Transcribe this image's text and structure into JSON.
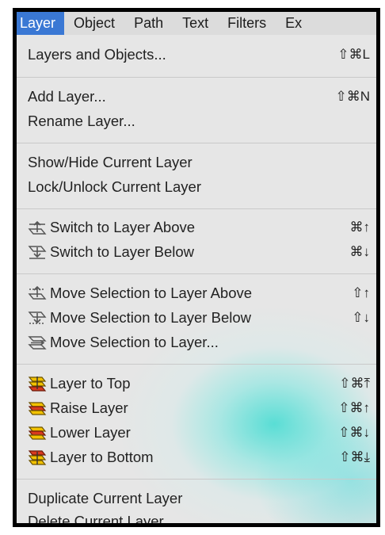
{
  "menubar": {
    "items": [
      "Layer",
      "Object",
      "Path",
      "Text",
      "Filters",
      "Ex"
    ]
  },
  "menu": {
    "layers_objects": {
      "label": "Layers and Objects...",
      "shortcut": "⇧⌘L"
    },
    "add_layer": {
      "label": "Add Layer...",
      "shortcut": "⇧⌘N"
    },
    "rename_layer": {
      "label": "Rename Layer..."
    },
    "show_hide": {
      "label": "Show/Hide Current Layer"
    },
    "lock_unlock": {
      "label": "Lock/Unlock Current Layer"
    },
    "switch_above": {
      "label": "Switch to Layer Above",
      "shortcut": "⌘↑"
    },
    "switch_below": {
      "label": "Switch to Layer Below",
      "shortcut": "⌘↓"
    },
    "move_sel_above": {
      "label": "Move Selection to Layer Above",
      "shortcut": "⇧↑"
    },
    "move_sel_below": {
      "label": "Move Selection to Layer Below",
      "shortcut": "⇧↓"
    },
    "move_sel_to": {
      "label": "Move Selection to Layer..."
    },
    "layer_top": {
      "label": "Layer to Top",
      "shortcut": "⇧⌘⤒"
    },
    "raise_layer": {
      "label": "Raise Layer",
      "shortcut": "⇧⌘↑"
    },
    "lower_layer": {
      "label": "Lower Layer",
      "shortcut": "⇧⌘↓"
    },
    "layer_bottom": {
      "label": "Layer to Bottom",
      "shortcut": "⇧⌘⤓"
    },
    "duplicate": {
      "label": "Duplicate Current Layer"
    },
    "delete": {
      "label": "Delete Current Layer"
    }
  },
  "colors": {
    "highlight": "#3a78d4",
    "menu_bg": "#e6e6e6",
    "layer_icon_yellow": "#f2c200",
    "layer_icon_red": "#d83a1f"
  }
}
